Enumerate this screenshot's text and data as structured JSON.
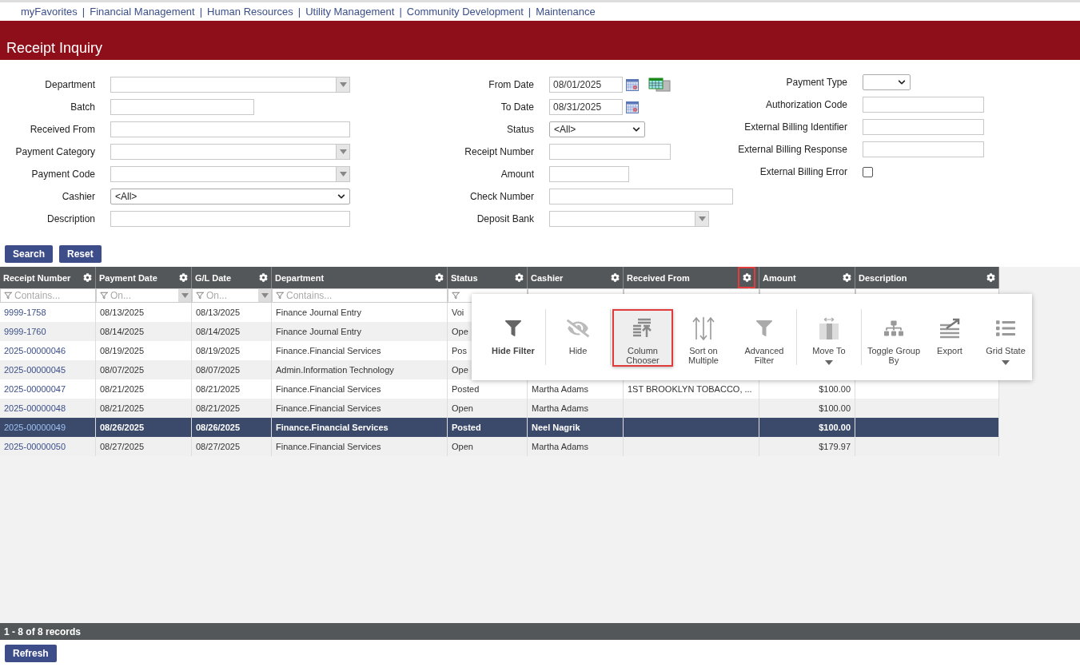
{
  "nav": {
    "separator": "|",
    "links": [
      "myFavorites",
      "Financial Management",
      "Human Resources",
      "Utility Management",
      "Community Development",
      "Maintenance"
    ]
  },
  "page_title": "Receipt Inquiry",
  "form": [
    [
      {
        "label": "Department",
        "kind": "combo"
      },
      {
        "label": "Batch",
        "kind": "text"
      },
      {
        "label": "Received From",
        "kind": "text"
      },
      {
        "label": "Payment Category",
        "kind": "combo"
      },
      {
        "label": "Payment Code",
        "kind": "combo"
      },
      {
        "label": "Cashier",
        "kind": "select",
        "value": "<All>"
      },
      {
        "label": "Description",
        "kind": "text"
      }
    ],
    [
      {
        "label": "From Date",
        "kind": "date",
        "value": "08/01/2025",
        "grid_button": true
      },
      {
        "label": "To Date",
        "kind": "date",
        "value": "08/31/2025"
      },
      {
        "label": "Status",
        "kind": "select",
        "value": "<All>"
      },
      {
        "label": "Receipt Number",
        "kind": "text"
      },
      {
        "label": "Amount",
        "kind": "text"
      },
      {
        "label": "Check Number",
        "kind": "text"
      },
      {
        "label": "Deposit Bank",
        "kind": "combo"
      }
    ],
    [
      {
        "label": "Payment Type",
        "kind": "select"
      },
      {
        "label": "Authorization Code",
        "kind": "text"
      },
      {
        "label": "External Billing Identifier",
        "kind": "text"
      },
      {
        "label": "External Billing Response",
        "kind": "text"
      },
      {
        "label": "External Billing Error",
        "kind": "checkbox",
        "checked": false
      }
    ]
  ],
  "buttons": [
    "Search",
    "Reset"
  ],
  "grid": {
    "columns": [
      {
        "title": "Receipt Number",
        "filter": "Contains...",
        "filter_icon": true,
        "filter_dropdown": false,
        "menu_open": false
      },
      {
        "title": "Payment Date",
        "filter": "On...",
        "filter_icon": true,
        "filter_dropdown": true,
        "menu_open": false
      },
      {
        "title": "G/L Date",
        "filter": "On...",
        "filter_icon": true,
        "filter_dropdown": true,
        "menu_open": false
      },
      {
        "title": "Department",
        "filter": "Contains...",
        "filter_icon": true,
        "filter_dropdown": false,
        "menu_open": false
      },
      {
        "title": "Status",
        "filter_icon": true,
        "menu_open": false
      },
      {
        "title": "Cashier",
        "menu_open": false
      },
      {
        "title": "Received From",
        "menu_open": true
      },
      {
        "title": "Amount",
        "menu_open": false
      },
      {
        "title": "Description",
        "menu_open": false
      }
    ],
    "rows": [
      {
        "selected": false,
        "cells": [
          "9999-1758",
          "08/13/2025",
          "08/13/2025",
          "Finance Journal Entry",
          "Voi"
        ]
      },
      {
        "selected": false,
        "cells": [
          "9999-1760",
          "08/14/2025",
          "08/14/2025",
          "Finance Journal Entry",
          "Ope"
        ]
      },
      {
        "selected": false,
        "cells": [
          "2025-00000046",
          "08/19/2025",
          "08/19/2025",
          "Finance.Financial Services",
          "Pos"
        ]
      },
      {
        "selected": false,
        "cells": [
          "2025-00000045",
          "08/07/2025",
          "08/07/2025",
          "Admin.Information Technology",
          "Ope"
        ]
      },
      {
        "selected": false,
        "cells": [
          "2025-00000047",
          "08/21/2025",
          "08/21/2025",
          "Finance.Financial Services",
          "Posted",
          "Martha Adams",
          "1ST BROOKLYN TOBACCO, ...",
          "$100.00"
        ]
      },
      {
        "selected": false,
        "cells": [
          "2025-00000048",
          "08/21/2025",
          "08/21/2025",
          "Finance.Financial Services",
          "Open",
          "Martha Adams",
          null,
          "$100.00"
        ]
      },
      {
        "selected": true,
        "cells": [
          "2025-00000049",
          "08/26/2025",
          "08/26/2025",
          "Finance.Financial Services",
          "Posted",
          "Neel Nagrik",
          null,
          "$100.00"
        ]
      },
      {
        "selected": false,
        "cells": [
          "2025-00000050",
          "08/27/2025",
          "08/27/2025",
          "Finance.Financial Services",
          "Open",
          "Martha Adams",
          null,
          "$179.97"
        ]
      }
    ],
    "footer": "1 - 8 of 8 records"
  },
  "column_menu": [
    [
      {
        "label": "Hide Filter",
        "highlighted": false
      }
    ],
    [
      {
        "label": "Hide",
        "highlighted": false
      }
    ],
    [
      {
        "label": "Column Chooser",
        "highlighted": true
      },
      {
        "label": "Sort on Multiple",
        "highlighted": false
      },
      {
        "label": "Advanced Filter",
        "highlighted": false
      }
    ],
    [
      {
        "label": "Move To",
        "highlighted": false,
        "dropdown": true
      }
    ],
    [
      {
        "label": "Toggle Group By",
        "highlighted": false
      },
      {
        "label": "Export",
        "highlighted": false
      },
      {
        "label": "Grid State",
        "highlighted": false,
        "dropdown": true
      }
    ]
  ],
  "refresh_button": "Refresh"
}
